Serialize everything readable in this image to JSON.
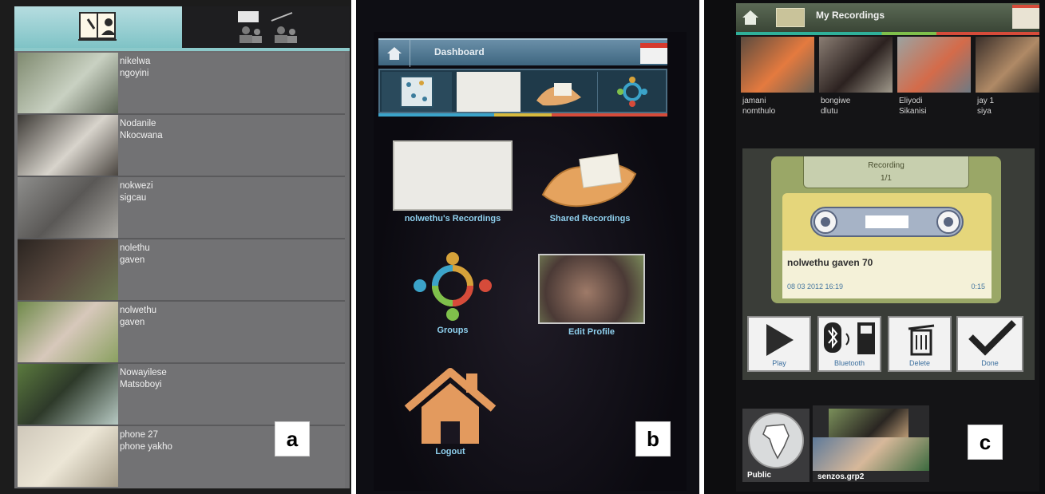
{
  "panel_a": {
    "badge": "a",
    "contacts": [
      {
        "line1": "nikelwa",
        "line2": "ngoyini"
      },
      {
        "line1": "Nodanile",
        "line2": "Nkocwana"
      },
      {
        "line1": "nokwezi",
        "line2": "sigcau"
      },
      {
        "line1": "nolethu",
        "line2": "gaven"
      },
      {
        "line1": "nolwethu",
        "line2": "gaven"
      },
      {
        "line1": "Nowayilese",
        "line2": "Matsoboyi"
      },
      {
        "line1": "phone 27",
        "line2": "phone yakho"
      }
    ]
  },
  "panel_b": {
    "badge": "b",
    "header_title": "Dashboard",
    "tiles": {
      "recordings": "nolwethu's Recordings",
      "shared": "Shared Recordings",
      "groups": "Groups",
      "edit_profile": "Edit Profile",
      "logout": "Logout"
    }
  },
  "panel_c": {
    "badge": "c",
    "header_title": "My Recordings",
    "thumbs": [
      {
        "line1": "jamani",
        "line2": "nomthulo"
      },
      {
        "line1": "bongiwe",
        "line2": "dlutu"
      },
      {
        "line1": "Eliyodi",
        "line2": "Sikanisi"
      },
      {
        "line1": "jay 1",
        "line2": "siya"
      }
    ],
    "recording_label": "Recording",
    "recording_count": "1/1",
    "recording_name": "nolwethu gaven 70",
    "recording_date": "08 03 2012 16:19",
    "recording_duration": "0:15",
    "controls": {
      "play": "Play",
      "bluetooth": "Bluetooth",
      "delete": "Delete",
      "done": "Done"
    },
    "groups": {
      "public": "Public",
      "group2": "senzos.grp2"
    }
  }
}
